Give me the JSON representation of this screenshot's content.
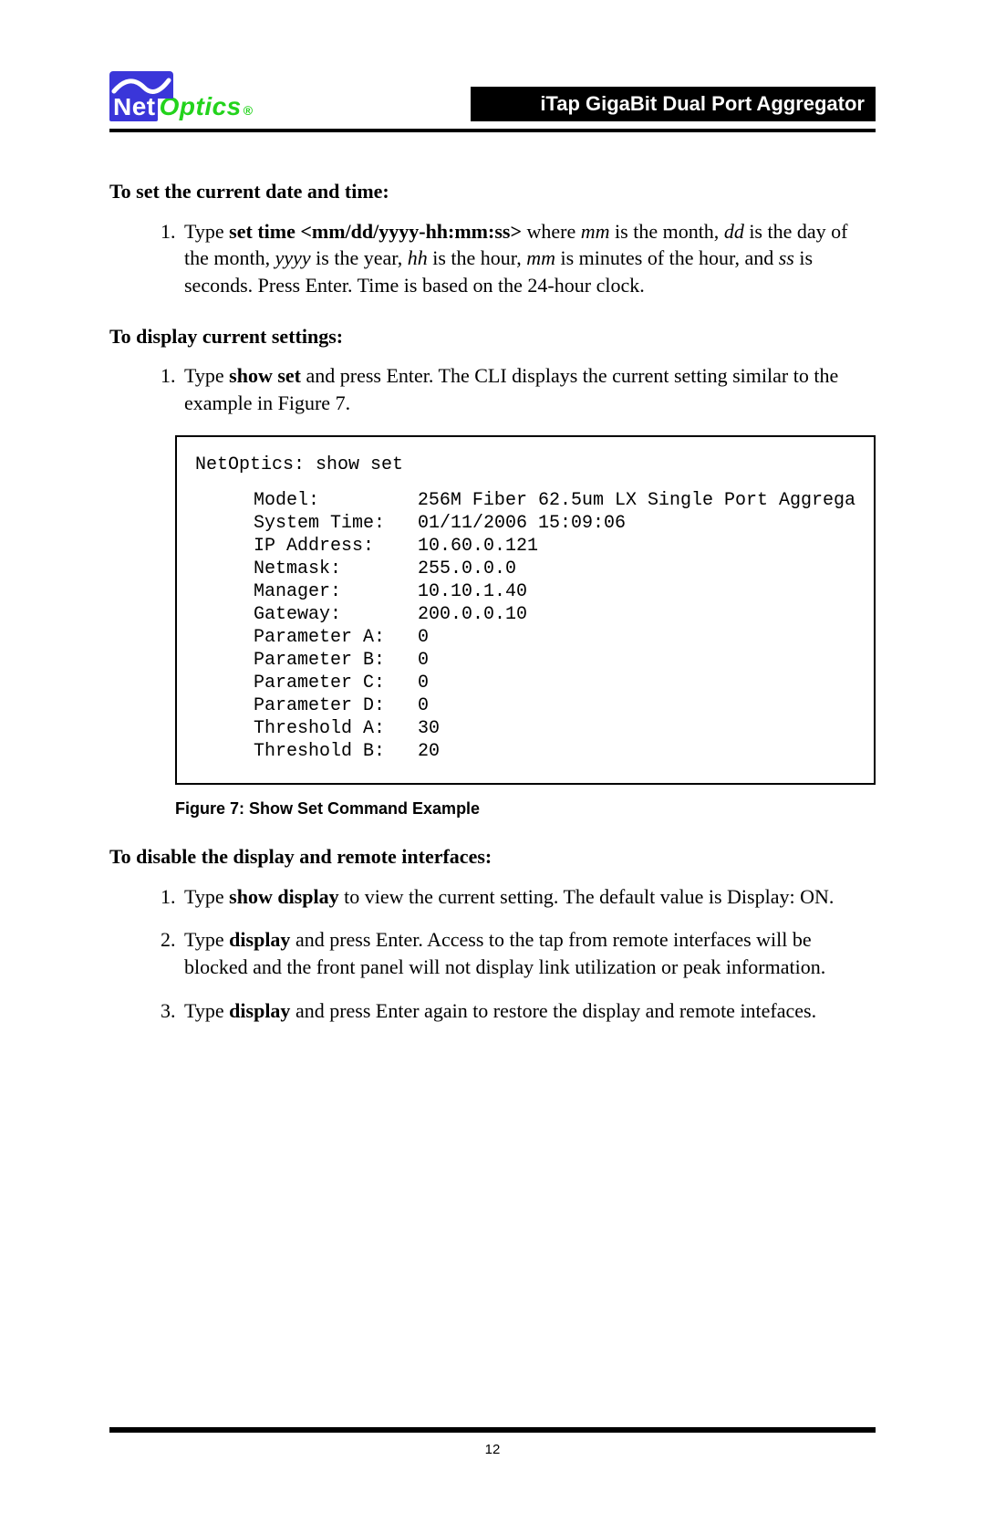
{
  "header": {
    "logo_net": "Net",
    "logo_optics": "Optics",
    "logo_reg": "®",
    "title": "iTap GigaBit Dual Port Aggregator"
  },
  "sections": {
    "set_time_title": "To set the current date and time:",
    "set_time_step_prefix": "Type ",
    "set_time_cmd": "set time <mm/dd/yyyy-hh:mm:ss>",
    "set_time_where": " where ",
    "set_time_mm1": "mm",
    "set_time_text1": " is the month, ",
    "set_time_dd": "dd",
    "set_time_text2": " is the day of the month, ",
    "set_time_yyyy": "yyyy",
    "set_time_text3": " is the year, ",
    "set_time_hh": "hh",
    "set_time_text4": " is the hour, ",
    "set_time_mm2": "mm",
    "set_time_text5": " is minutes of the hour, and ",
    "set_time_ss": "ss",
    "set_time_text6": " is seconds. Press Enter. Time is based on the 24-hour clock.",
    "show_set_title": "To display current settings:",
    "show_set_step_prefix": "Type ",
    "show_set_cmd": "show set",
    "show_set_rest": " and press Enter. The CLI displays the current setting similar to the example in Figure 7.",
    "disable_title": "To disable the display and remote interfaces:",
    "disable1_prefix": "Type ",
    "disable1_cmd": "show display",
    "disable1_rest": " to view the current setting. The default value is Display: ON.",
    "disable2_prefix": "Type ",
    "disable2_cmd": "display",
    "disable2_rest": " and press Enter. Access to the tap from remote interfaces will be blocked and the front panel will not display link utilization or peak information.",
    "disable3_prefix": "Type ",
    "disable3_cmd": "display",
    "disable3_rest": " and press Enter again to restore the display and remote intefaces."
  },
  "cli": {
    "prompt": "NetOptics: show set",
    "rows": [
      {
        "label": "Model:",
        "value": "256M Fiber 62.5um LX Single Port Aggrega"
      },
      {
        "label": "System Time:",
        "value": "01/11/2006 15:09:06"
      },
      {
        "label": "IP Address:",
        "value": "10.60.0.121"
      },
      {
        "label": "Netmask:",
        "value": "255.0.0.0"
      },
      {
        "label": "Manager:",
        "value": "10.10.1.40"
      },
      {
        "label": "Gateway:",
        "value": "200.0.0.10"
      },
      {
        "label": "Parameter A:",
        "value": "0"
      },
      {
        "label": "Parameter B:",
        "value": "0"
      },
      {
        "label": "Parameter C:",
        "value": "0"
      },
      {
        "label": "Parameter D:",
        "value": "0"
      },
      {
        "label": "Threshold A:",
        "value": "30"
      },
      {
        "label": "Threshold B:",
        "value": "20"
      }
    ]
  },
  "figure": {
    "label": "Figure 7:",
    "text": " Show Set Command Example"
  },
  "footer": {
    "page": "12"
  }
}
